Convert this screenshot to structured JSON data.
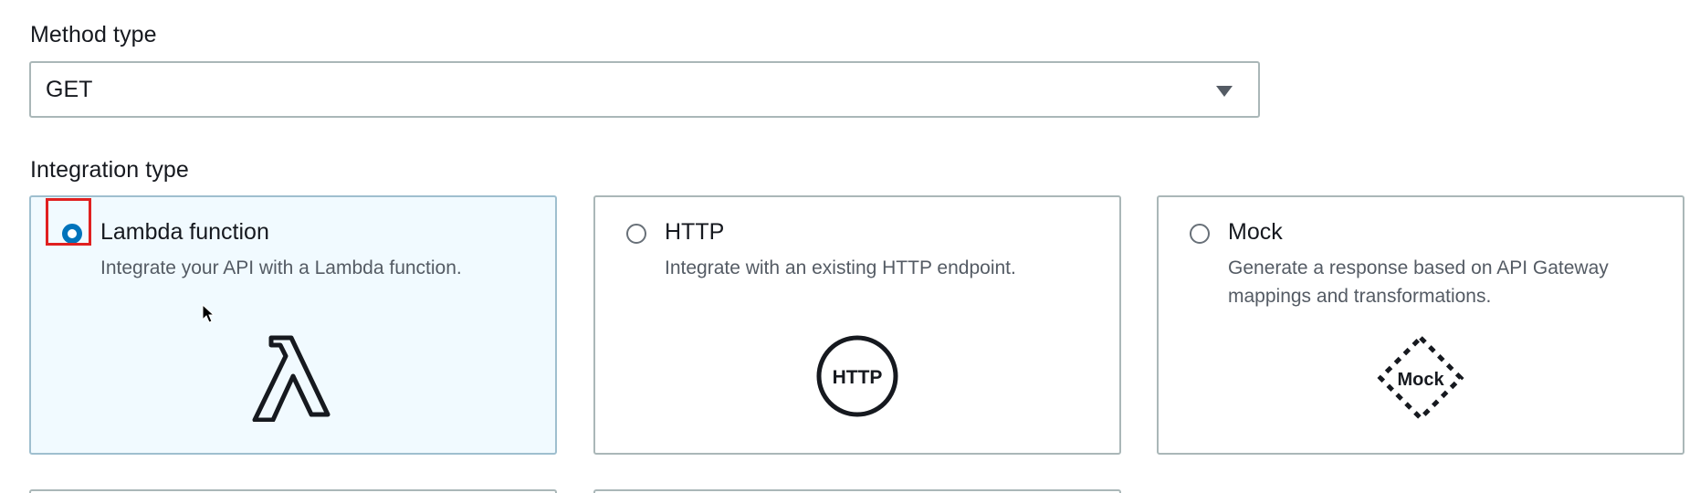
{
  "method": {
    "label": "Method type",
    "selected": "GET",
    "caret_icon": "caret-down-icon"
  },
  "integration": {
    "label": "Integration type",
    "options": [
      {
        "title": "Lambda function",
        "description": "Integrate your API with a Lambda function.",
        "icon": "lambda-icon",
        "selected": true
      },
      {
        "title": "HTTP",
        "description": "Integrate with an existing HTTP endpoint.",
        "icon": "http-icon",
        "icon_text": "HTTP",
        "selected": false
      },
      {
        "title": "Mock",
        "description": "Generate a response based on API Gateway mappings and transformations.",
        "icon": "mock-icon",
        "icon_text": "Mock",
        "selected": false
      }
    ]
  },
  "colors": {
    "accent": "#0073bb",
    "selected_tile_bg": "#f1faff",
    "border": "#aab7b8",
    "highlight": "#e02020",
    "text": "#16191f",
    "muted_text": "#545b64"
  }
}
